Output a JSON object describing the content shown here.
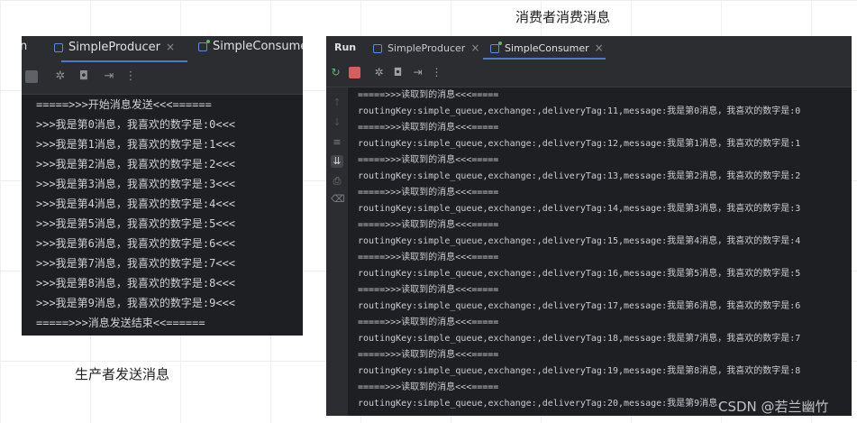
{
  "captions": {
    "consumer": "消费者消费消息",
    "producer": "生产者发送消息"
  },
  "left_panel": {
    "run_label_partial": "n",
    "tabs": [
      {
        "label": "SimpleProducer",
        "close": "×"
      },
      {
        "label": "SimpleConsume"
      }
    ],
    "lines": [
      "=====>>>开始消息发送<<<======",
      ">>>我是第0消息，我喜欢的数字是:0<<<",
      ">>>我是第1消息，我喜欢的数字是:1<<<",
      ">>>我是第2消息，我喜欢的数字是:2<<<",
      ">>>我是第3消息，我喜欢的数字是:3<<<",
      ">>>我是第4消息，我喜欢的数字是:4<<<",
      ">>>我是第5消息，我喜欢的数字是:5<<<",
      ">>>我是第6消息，我喜欢的数字是:6<<<",
      ">>>我是第7消息，我喜欢的数字是:7<<<",
      ">>>我是第8消息，我喜欢的数字是:8<<<",
      ">>>我是第9消息，我喜欢的数字是:9<<<",
      "=====>>>消息发送结束<<======"
    ]
  },
  "right_panel": {
    "run_label": "Run",
    "tabs": [
      {
        "label": "SimpleProducer",
        "close": "×"
      },
      {
        "label": "SimpleConsumer",
        "close": "×"
      }
    ],
    "lines": [
      "=====>>>读取到的消息<<<=====",
      "routingKey:simple_queue,exchange:,deliveryTag:11,message:我是第0消息，我喜欢的数字是:0",
      "=====>>>读取到的消息<<<=====",
      "routingKey:simple_queue,exchange:,deliveryTag:12,message:我是第1消息，我喜欢的数字是:1",
      "=====>>>读取到的消息<<<=====",
      "routingKey:simple_queue,exchange:,deliveryTag:13,message:我是第2消息，我喜欢的数字是:2",
      "=====>>>读取到的消息<<<=====",
      "routingKey:simple_queue,exchange:,deliveryTag:14,message:我是第3消息，我喜欢的数字是:3",
      "=====>>>读取到的消息<<<=====",
      "routingKey:simple_queue,exchange:,deliveryTag:15,message:我是第4消息，我喜欢的数字是:4",
      "=====>>>读取到的消息<<<=====",
      "routingKey:simple_queue,exchange:,deliveryTag:16,message:我是第5消息，我喜欢的数字是:5",
      "=====>>>读取到的消息<<<=====",
      "routingKey:simple_queue,exchange:,deliveryTag:17,message:我是第6消息，我喜欢的数字是:6",
      "=====>>>读取到的消息<<<=====",
      "routingKey:simple_queue,exchange:,deliveryTag:18,message:我是第7消息，我喜欢的数字是:7",
      "=====>>>读取到的消息<<<=====",
      "routingKey:simple_queue,exchange:,deliveryTag:19,message:我是第8消息，我喜欢的数字是:8",
      "=====>>>读取到的消息<<<=====",
      "routingKey:simple_queue,exchange:,deliveryTag:20,message:我是第9消息，"
    ]
  },
  "watermark": "CSDN @若兰幽竹"
}
